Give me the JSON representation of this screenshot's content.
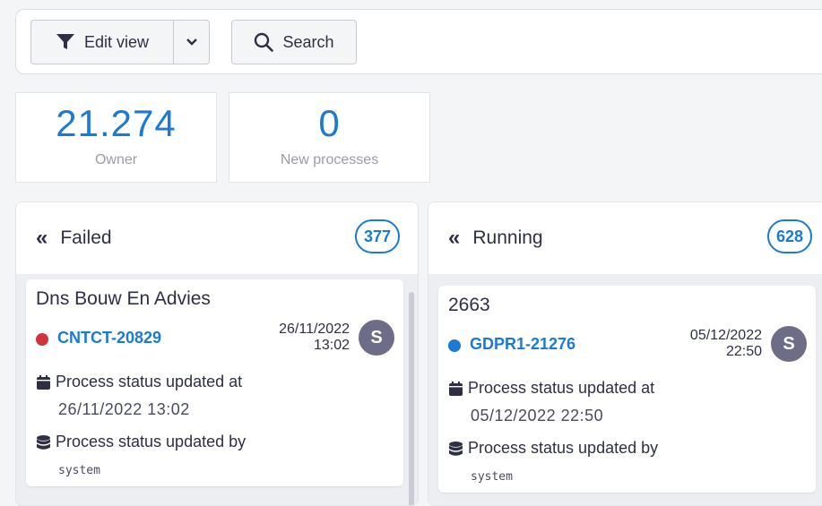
{
  "toolbar": {
    "edit_view_label": "Edit view",
    "search_label": "Search"
  },
  "stats": {
    "owner": {
      "value": "21.274",
      "label": "Owner"
    },
    "new_processes": {
      "value": "0",
      "label": "New processes"
    }
  },
  "columns": {
    "failed": {
      "title": "Failed",
      "count": "377",
      "card": {
        "name": "Dns Bouw En Advies",
        "ref": "CNTCT-20829",
        "status_color": "#d0333a",
        "date": "26/11/2022",
        "time": "13:02",
        "avatar": "S",
        "updated_at_label": "Process status updated at",
        "updated_at_value": "26/11/2022 13:02",
        "updated_by_label": "Process status updated by",
        "updated_by_value": "system"
      }
    },
    "running": {
      "title": "Running",
      "count": "628",
      "card": {
        "name": "2663",
        "ref": "GDPR1-21276",
        "status_color": "#1a7ad4",
        "date": "05/12/2022",
        "time": "22:50",
        "avatar": "S",
        "updated_at_label": "Process status updated at",
        "updated_at_value": "05/12/2022 22:50",
        "updated_by_label": "Process status updated by",
        "updated_by_value": "system"
      }
    }
  },
  "colors": {
    "accent": "#1a7ad4",
    "failed": "#d0333a",
    "avatar_bg": "#6e6d87"
  }
}
